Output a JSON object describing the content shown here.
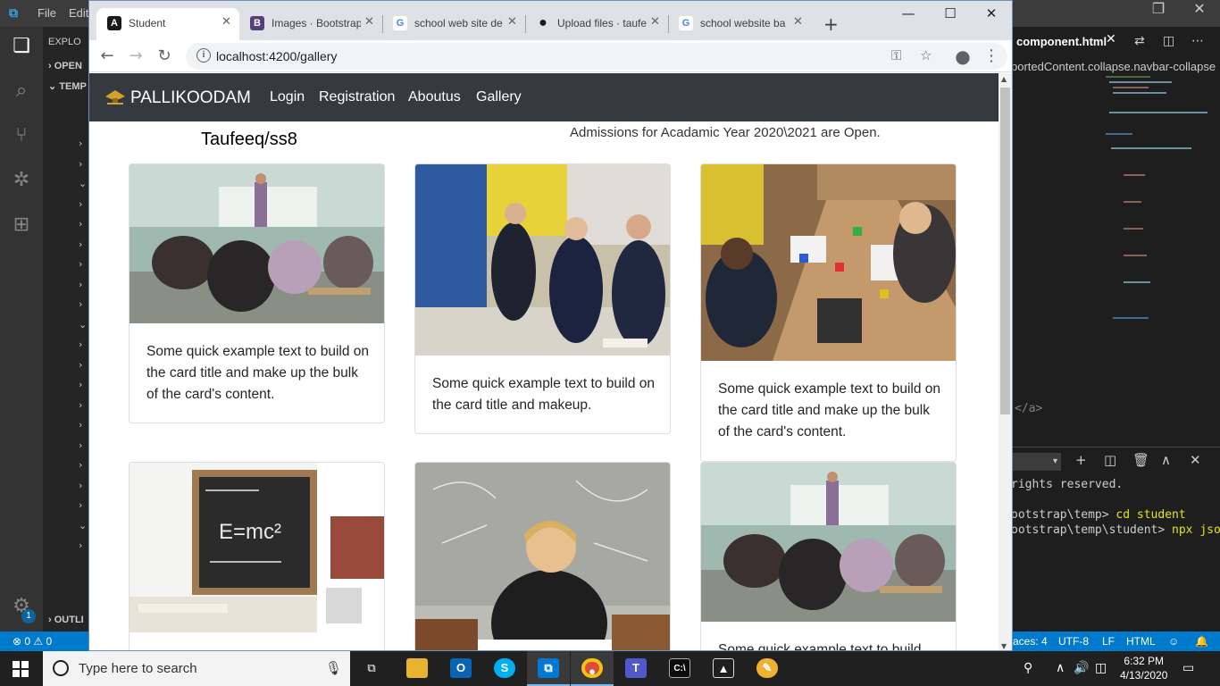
{
  "vscode": {
    "menu": [
      "File",
      "Edit"
    ],
    "sidebar": {
      "explorer_label": "EXPLO",
      "open_editors": "OPEN",
      "temp": "TEMP",
      "outline": "OUTLI"
    },
    "editor_tab": "component.html",
    "breadcrumb": "portedContent.collapse.navbar-collapse",
    "code_fragment": "</a>",
    "terminal": {
      "lines": [
        "rights reserved.",
        "",
        "ootstrap\\temp> ",
        "ootstrap\\temp\\student> "
      ],
      "cmd1": "cd student",
      "cmd2": "npx json"
    },
    "status": {
      "problems": "⊗ 0 ⚠ 0",
      "spaces": "aces: 4",
      "encoding": "UTF-8",
      "eol": "LF",
      "language": "HTML"
    },
    "badge": "1"
  },
  "browser": {
    "tabs": [
      {
        "title": "Student",
        "favicon": "A",
        "color": "#1a1a1a"
      },
      {
        "title": "Images · Bootstrap",
        "favicon": "B",
        "color": "#563d7c"
      },
      {
        "title": "school web site de",
        "favicon": "G",
        "color": "#4285f4"
      },
      {
        "title": "Upload files · taufe",
        "favicon": "●",
        "color": "#1a1a1a"
      },
      {
        "title": "school website ba",
        "favicon": "G",
        "color": "#4285f4"
      }
    ],
    "url": "localhost:4200/gallery"
  },
  "page": {
    "brand": "PALLIKOODAM",
    "nav": [
      "Login",
      "Registration",
      "Aboutus",
      "Gallery"
    ],
    "user": "Taufeeq/ss8",
    "admission": "Admissions for Acadamic Year 2020\\2021 are Open.",
    "cards": [
      {
        "text": "Some quick example text to build on the card title and make up the bulk of the card's content.",
        "image": "classroom-photo"
      },
      {
        "text": "Some quick example text to build on the card title and makeup.",
        "image": "students-activity-photo"
      },
      {
        "text": "Some quick example text to build on the card title and make up the bulk of the card's content.",
        "image": "kids-blocks-photo"
      },
      {
        "text": "",
        "image": "chalkboard-emc2-photo"
      },
      {
        "text": "",
        "image": "teacher-desk-photo"
      },
      {
        "text": "Some quick example text to build",
        "image": "classroom-photo"
      }
    ]
  },
  "taskbar": {
    "search_placeholder": "Type here to search",
    "time": "6:32 PM",
    "date": "4/13/2020"
  }
}
